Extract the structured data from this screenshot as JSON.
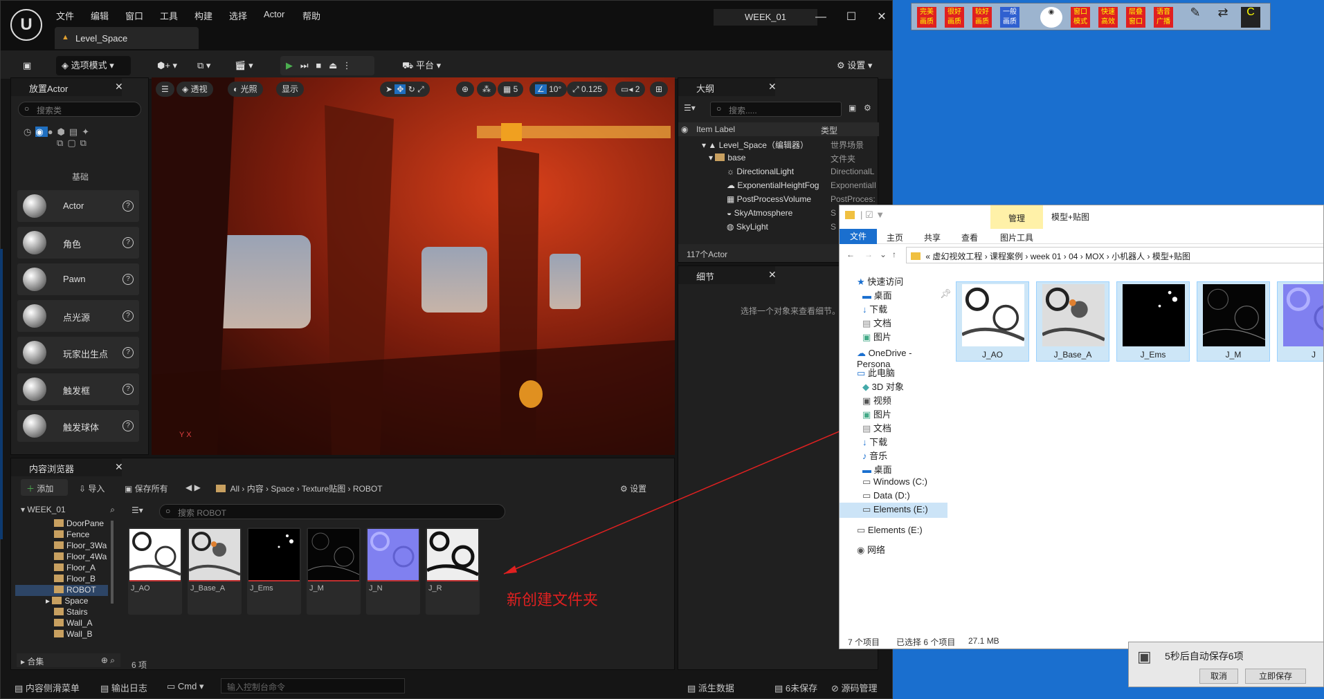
{
  "ue": {
    "menu": [
      "文件",
      "编辑",
      "窗口",
      "工具",
      "构建",
      "选择",
      "Actor",
      "帮助"
    ],
    "level_tab": "Level_Space",
    "project": "WEEK_01",
    "toolbar": {
      "mode": "选项模式",
      "platform": "平台",
      "settings": "设置"
    },
    "place_actor": {
      "title": "放置Actor",
      "search_placeholder": "搜索类",
      "category": "基础",
      "items": [
        "Actor",
        "角色",
        "Pawn",
        "点光源",
        "玩家出生点",
        "触发框",
        "触发球体"
      ]
    },
    "viewport": {
      "perspective": "透视",
      "lit": "光照",
      "show": "显示",
      "grid": "5",
      "rot": "10°",
      "scale": "0.125",
      "cam": "2"
    },
    "outliner": {
      "title": "大纲",
      "search_placeholder": "搜索.....",
      "col_label": "Item Label",
      "col_type": "类型",
      "rows": [
        {
          "label": "Level_Space（编辑器）",
          "type": "世界场景"
        },
        {
          "label": "base",
          "type": "文件夹"
        },
        {
          "label": "DirectionalLight",
          "type": "DirectionalL"
        },
        {
          "label": "ExponentialHeightFog",
          "type": "ExponentialI"
        },
        {
          "label": "PostProcessVolume",
          "type": "PostProces:"
        },
        {
          "label": "SkyAtmosphere",
          "type": "S"
        },
        {
          "label": "SkyLight",
          "type": "S"
        }
      ],
      "count": "117个Actor"
    },
    "details": {
      "title": "细节",
      "empty": "选择一个对象来查看细节。"
    },
    "content_browser": {
      "title": "内容浏览器",
      "add": "添加",
      "import": "导入",
      "save_all": "保存所有",
      "settings": "设置",
      "path": [
        "All",
        "内容",
        "Space",
        "Texture贴图",
        "ROBOT"
      ],
      "root": "WEEK_01",
      "search_placeholder": "搜索 ROBOT",
      "tree": [
        "DoorPane",
        "Fence",
        "Floor_3Wa",
        "Floor_4Wa",
        "Floor_A",
        "Floor_B",
        "ROBOT",
        "Space",
        "Stairs",
        "Wall_A",
        "Wall_B"
      ],
      "collections": "合集",
      "assets": [
        "J_AO",
        "J_Base_A",
        "J_Ems",
        "J_M",
        "J_N",
        "J_R"
      ],
      "count": "6 项"
    },
    "statusbar": {
      "drawer": "内容侧滑菜单",
      "log": "输出日志",
      "cmd": "Cmd",
      "cmd_placeholder": "输入控制台命令",
      "derived": "派生数据",
      "unsaved": "6未保存",
      "source": "源码管理"
    }
  },
  "annotation": "新创建文件夹",
  "explorer": {
    "manage": "管理",
    "title": "模型+贴图",
    "ribbon_tabs": [
      "文件",
      "主页",
      "共享",
      "查看",
      "图片工具"
    ],
    "path": [
      "虚幻视效工程",
      "课程案例",
      "week 01",
      "04",
      "MOX",
      "小机器人",
      "模型+贴图"
    ],
    "nav": [
      "快速访问",
      "桌面",
      "下载",
      "文档",
      "图片",
      "OneDrive - Persona",
      "此电脑",
      "3D 对象",
      "视频",
      "图片",
      "文档",
      "下载",
      "音乐",
      "桌面",
      "Windows (C:)",
      "Data (D:)",
      "Elements (E:)",
      "Elements (E:)",
      "网络"
    ],
    "files": [
      "J_AO",
      "J_Base_A",
      "J_Ems",
      "J_M",
      "J"
    ],
    "status": {
      "items": "7 个项目",
      "selected": "已选择 6 个项目",
      "size": "27.1 MB"
    }
  },
  "quick_bar": [
    "完美画质",
    "很好画质",
    "较好画质",
    "一般画质",
    "窗口模式",
    "快速高效",
    "层叠窗口",
    "语音广播"
  ],
  "toast": {
    "msg": "5秒后自动保存6项",
    "cancel": "取消",
    "save": "立即保存"
  }
}
